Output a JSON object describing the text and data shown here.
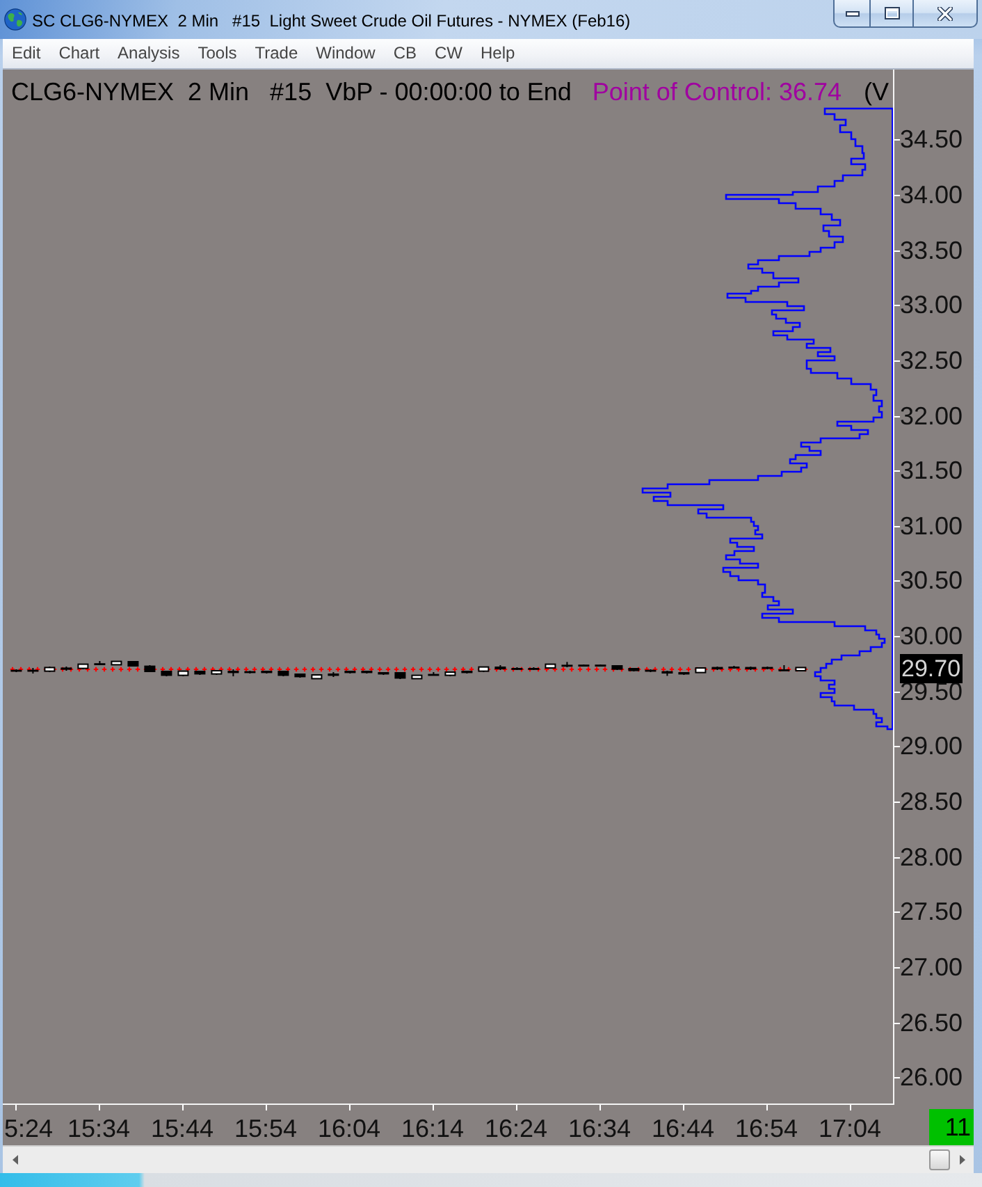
{
  "window": {
    "title": "SC CLG6-NYMEX  2 Min   #15  Light Sweet Crude Oil Futures - NYMEX (Feb16)"
  },
  "menu": [
    "Edit",
    "Chart",
    "Analysis",
    "Tools",
    "Trade",
    "Window",
    "CB",
    "CW",
    "Help"
  ],
  "chart": {
    "header": "CLG6-NYMEX  2 Min   #15  VbP - 00:00:00 to End",
    "point_of_control": "Point of Control: 36.74",
    "header_fragment": "(V",
    "price_labels": [
      "34.50",
      "34.00",
      "33.50",
      "33.00",
      "32.50",
      "32.00",
      "31.50",
      "31.00",
      "30.50",
      "30.00",
      "29.50",
      "29.00",
      "28.50",
      "28.00",
      "27.50",
      "27.00",
      "26.50",
      "26.00"
    ],
    "last_price": "29.70",
    "time_labels": [
      "5:24",
      "15:34",
      "15:44",
      "15:54",
      "16:04",
      "16:14",
      "16:24",
      "16:34",
      "16:44",
      "16:54",
      "17:04"
    ],
    "bar_counter": "11"
  }
}
